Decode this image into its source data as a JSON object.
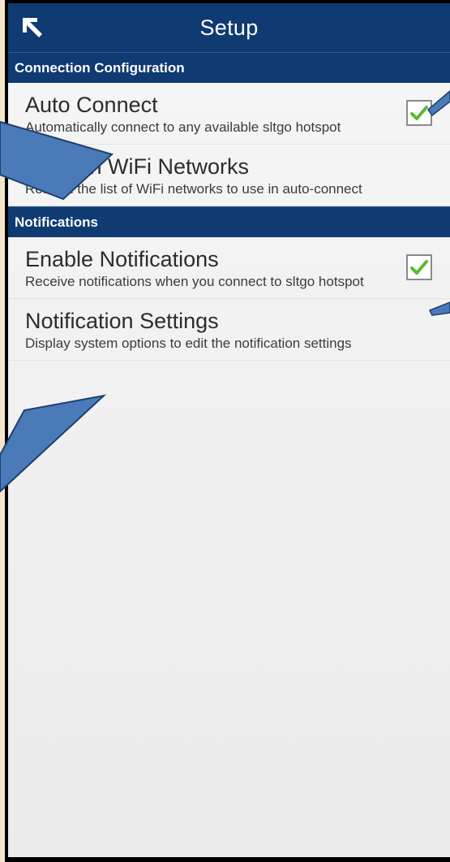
{
  "appbar": {
    "title": "Setup",
    "back_icon": "back-arrow-icon"
  },
  "sections": [
    {
      "header": "Connection Configuration",
      "items": [
        {
          "title": "Auto Connect",
          "subtitle": "Automatically connect to any available sltgo hotspot",
          "checked": true
        },
        {
          "title": "Refresh WiFi Networks",
          "subtitle": "Refresh the list of WiFi networks to use in auto-connect"
        }
      ]
    },
    {
      "header": "Notifications",
      "items": [
        {
          "title": "Enable Notifications",
          "subtitle": "Receive notifications when you connect to sltgo hotspot",
          "checked": true
        },
        {
          "title": "Notification Settings",
          "subtitle": "Display system options to edit the notification settings"
        }
      ]
    }
  ],
  "colors": {
    "appbar": "#0f3a72",
    "annotation_arrow": "#4a7bb8",
    "check": "#5cb82e"
  }
}
